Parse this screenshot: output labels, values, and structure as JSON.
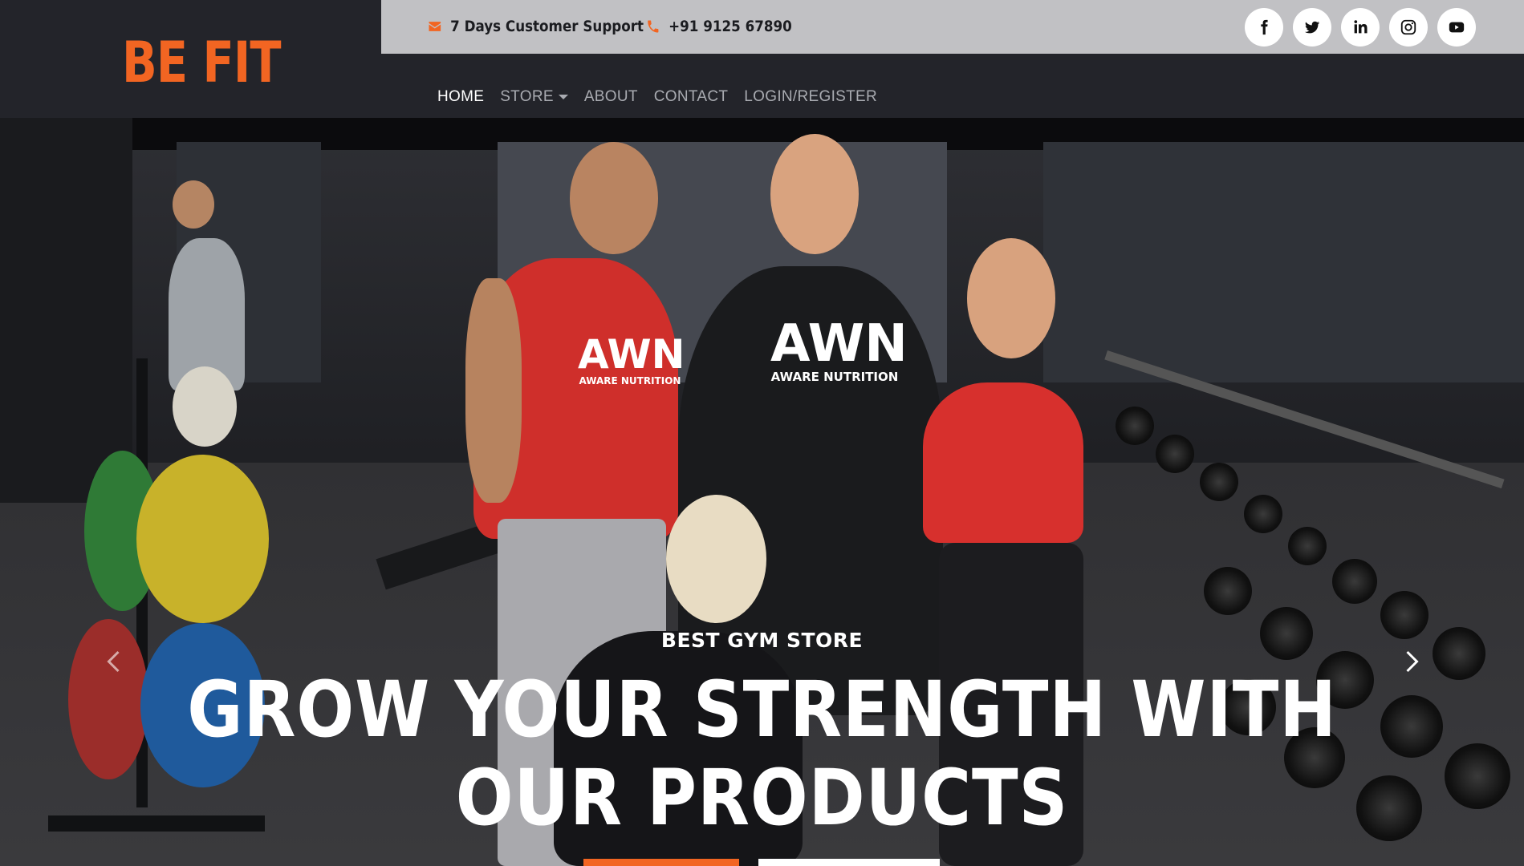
{
  "brand": {
    "logo": "BE FIT",
    "accent": "#f26522"
  },
  "topbar": {
    "support_text": "7 Days Customer Support",
    "phone": "+91 9125 67890",
    "support_icon": "envelope-icon",
    "phone_icon": "phone-icon",
    "socials": [
      "facebook-icon",
      "twitter-icon",
      "linkedin-icon",
      "instagram-icon",
      "youtube-icon"
    ]
  },
  "nav": {
    "items": [
      {
        "label": "HOME",
        "active": true
      },
      {
        "label": "STORE",
        "dropdown": true
      },
      {
        "label": "ABOUT"
      },
      {
        "label": "CONTACT"
      },
      {
        "label": "LOGIN/REGISTER"
      }
    ]
  },
  "hero": {
    "subtitle": "BEST GYM STORE",
    "headline_line1": "GROW YOUR STRENGTH WITH",
    "headline_line2": "OUR PRODUCTS",
    "shirt_brand": "AWN",
    "shirt_tagline": "AWARE NUTRITION",
    "prev_icon": "chevron-left-icon",
    "next_icon": "chevron-right-icon"
  }
}
